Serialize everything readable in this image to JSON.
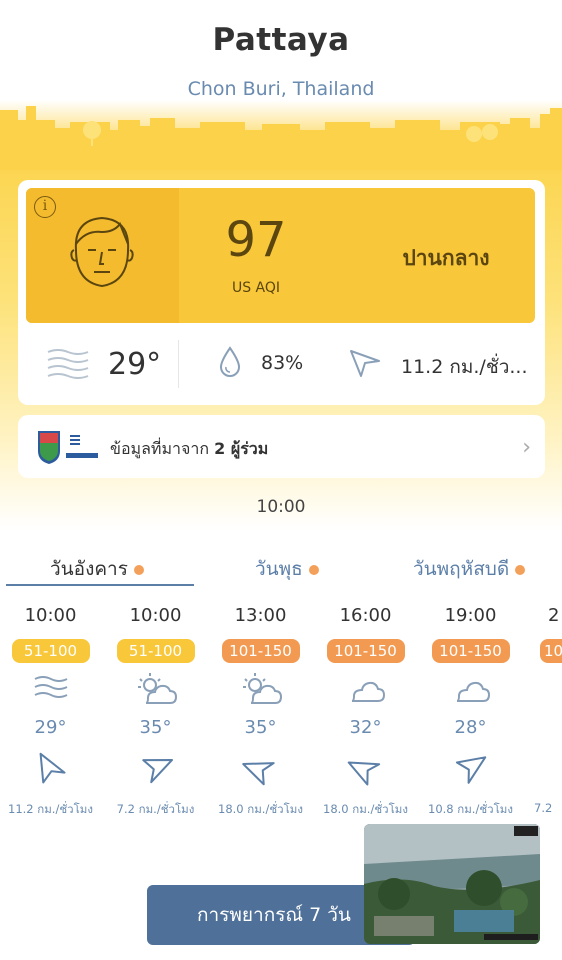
{
  "header": {
    "city": "Pattaya",
    "region": "Chon Buri, Thailand"
  },
  "aqi": {
    "info_icon": "i",
    "value": "97",
    "unit": "US AQI",
    "status": "ปานกลาง",
    "color": "#f8c73a"
  },
  "stats": {
    "temperature": "29°",
    "humidity": "83%",
    "wind": "11.2 กม./ชั่ว..."
  },
  "contributors": {
    "text_prefix": "ข้อมูลที่มาจาก",
    "count_text": "2 ผู้ร่วม"
  },
  "update_time": "10:00",
  "day_tabs": [
    {
      "label": "วันอังคาร"
    },
    {
      "label": "วันพุธ"
    },
    {
      "label": "วันพฤหัสบดี"
    }
  ],
  "hourly": [
    {
      "time": "10:00",
      "aqi": "51-100",
      "aqi_color": "#f8c73a",
      "icon": "wind-icon",
      "temp": "29°",
      "dir": "southwest",
      "speed": "11.2 กม./ชั่วโมง"
    },
    {
      "time": "10:00",
      "aqi": "51-100",
      "aqi_color": "#f8c73a",
      "icon": "partly-sunny-icon",
      "temp": "35°",
      "dir": "southeast",
      "speed": "7.2 กม./ชั่วโมง"
    },
    {
      "time": "13:00",
      "aqi": "101-150",
      "aqi_color": "#f39a52",
      "icon": "partly-sunny-icon",
      "temp": "35°",
      "dir": "east",
      "speed": "18.0 กม./ชั่วโมง"
    },
    {
      "time": "16:00",
      "aqi": "101-150",
      "aqi_color": "#f39a52",
      "icon": "cloud-icon",
      "temp": "32°",
      "dir": "northwest",
      "speed": "18.0 กม./ชั่วโมง"
    },
    {
      "time": "19:00",
      "aqi": "101-150",
      "aqi_color": "#f39a52",
      "icon": "cloud-icon",
      "temp": "28°",
      "dir": "northeast",
      "speed": "10.8 กม./ชั่วโมง"
    },
    {
      "time": "2",
      "aqi": "10",
      "aqi_color": "#f39a52",
      "icon": "cloud-icon",
      "temp": "",
      "dir": "",
      "speed": "7.2"
    }
  ],
  "forecast_button": {
    "label": "การพยากรณ์ 7 วัน"
  }
}
